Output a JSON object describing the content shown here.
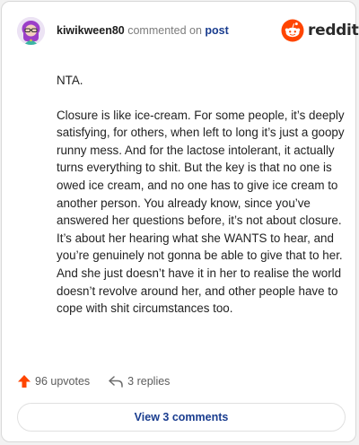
{
  "header": {
    "username": "kiwikween80",
    "action_text": " commented on ",
    "post_link": "post",
    "brand": "reddit"
  },
  "comment": {
    "paragraph_1": "NTA.",
    "paragraph_2": "Closure is like ice-cream. For some people, it’s deeply satisfying, for others, when left to long it’s just a goopy runny mess. And for the lactose intolerant, it actually turns everything to shit. But the key is that no one is owed ice cream, and no one has to give ice cream to another person. You already know, since you’ve answered her questions before, it’s not about closure. It’s about her hearing what she WANTS to hear, and you’re genuinely not gonna be able to give that to her. And she just doesn’t have it in her to realise the world doesn’t revolve around her, and other people have to cope with shit circumstances too."
  },
  "actions": {
    "upvotes": "96 upvotes",
    "replies": "3 replies"
  },
  "view_comments_label": "View 3 comments",
  "icons": {
    "avatar": "user-avatar",
    "logo": "reddit-snoo-icon",
    "upvote": "upvote-arrow-icon",
    "reply": "reply-arrow-icon"
  },
  "colors": {
    "brand_orange": "#ff4500",
    "upvote_orange": "#ff4500",
    "link_blue": "#1a3d8f"
  }
}
